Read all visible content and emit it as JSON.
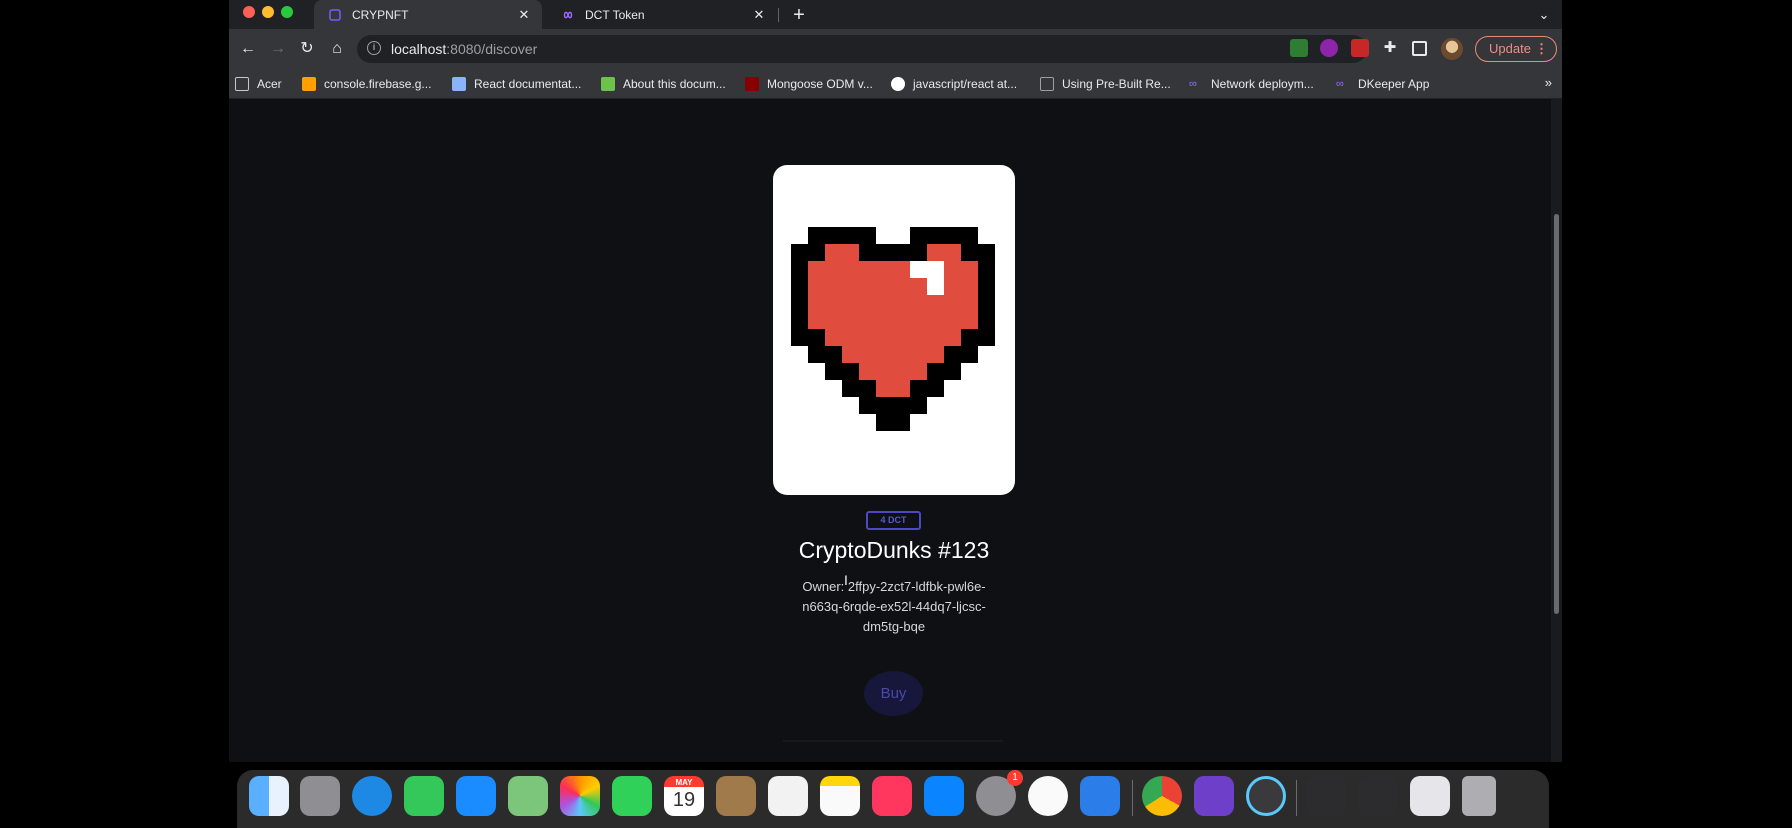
{
  "tabs": [
    {
      "title": "CRYPNFT",
      "active": true
    },
    {
      "title": "DCT Token",
      "active": false
    }
  ],
  "address_bar": {
    "host": "localhost",
    "path": ":8080/discover"
  },
  "toolbar": {
    "update_label": "Update"
  },
  "bookmarks": [
    {
      "label": "Acer",
      "icon": "folder-icon",
      "color": "#c8c8c8"
    },
    {
      "label": "console.firebase.g...",
      "icon": "firebase-icon",
      "color": "#ffa000"
    },
    {
      "label": "React documentat...",
      "icon": "react-doc-icon",
      "color": "#8ab4f8"
    },
    {
      "label": "About this docum...",
      "icon": "nodejs-icon",
      "color": "#6cc24a"
    },
    {
      "label": "Mongoose ODM v...",
      "icon": "mongoose-icon",
      "color": "#880000"
    },
    {
      "label": "javascript/react at...",
      "icon": "github-icon",
      "color": "#ffffff"
    },
    {
      "label": "Using Pre-Built Re...",
      "icon": "page-icon",
      "color": "#202124"
    },
    {
      "label": "Network deploym...",
      "icon": "infinity-icon",
      "color": "#7c5cff"
    },
    {
      "label": "DKeeper App",
      "icon": "infinity-icon",
      "color": "#7c5cff"
    }
  ],
  "nft": {
    "price": "4 DCT",
    "name": "CryptoDunks #123",
    "owner": "Owner: 2ffpy-2zct7-ldfbk-pwl6e-n663q-6rqde-ex52l-44dq7-ljcsc-dm5tg-bqe",
    "buy_label": "Buy"
  },
  "dock": {
    "calendar_month": "MAY",
    "calendar_day": "19",
    "settings_badge": "1"
  }
}
